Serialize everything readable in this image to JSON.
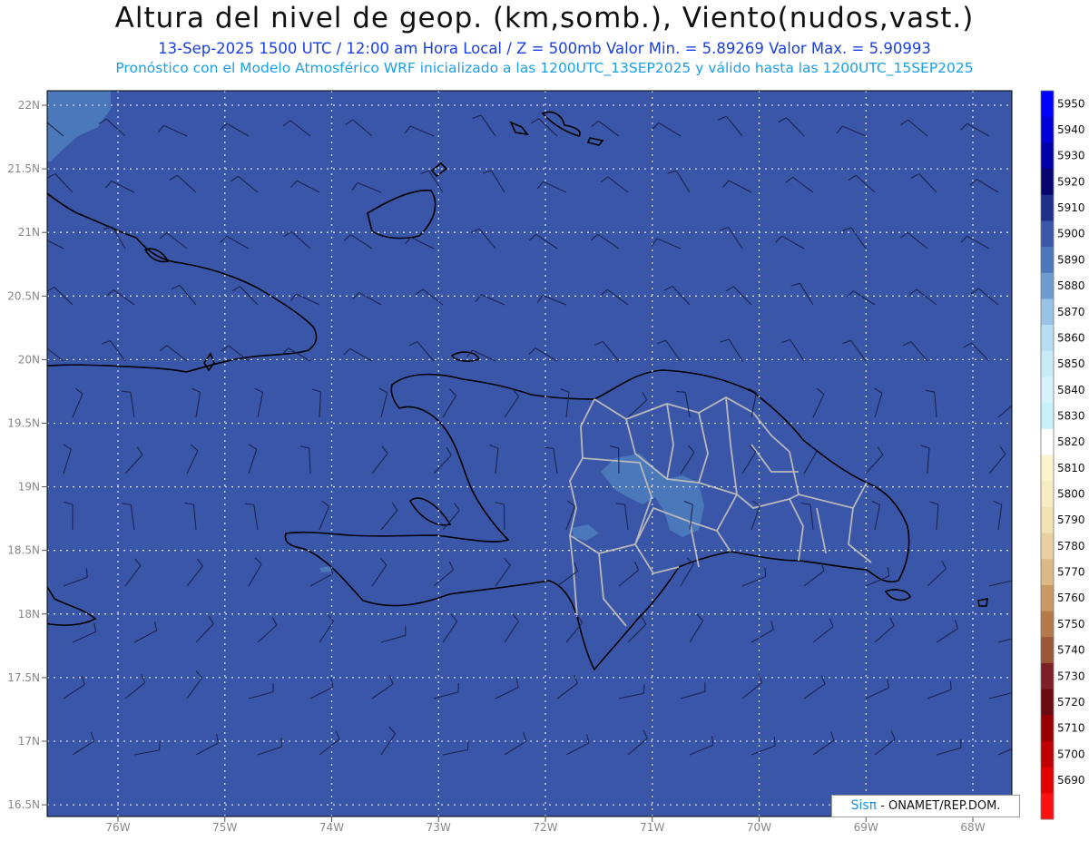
{
  "header": {
    "title": "Altura del nivel de geop. (km,somb.), Viento(nudos,vast.)",
    "subtitle_line1": "13-Sep-2025  1500 UTC / 12:00 am Hora Local / Z = 500mb    Valor Min. = 5.89269  Valor Max. = 5.90993",
    "subtitle_line2": "Pronóstico con el Modelo Atmosférico WRF inicializado a las 1200UTC_13SEP2025 y válido hasta las  1200UTC_15SEP2025"
  },
  "map": {
    "lat_labels": [
      "22N",
      "21.5N",
      "21N",
      "20.5N",
      "20N",
      "19.5N",
      "19N",
      "18.5N",
      "18N",
      "17.5N",
      "17N",
      "16.5N"
    ],
    "lon_labels": [
      "76W",
      "75W",
      "74W",
      "73W",
      "72W",
      "71W",
      "70W",
      "69W",
      "68W"
    ],
    "background_color": "#3a56a8",
    "grid": true
  },
  "colorbar": {
    "levels": [
      "5950",
      "5940",
      "5930",
      "5920",
      "5910",
      "5900",
      "5890",
      "5880",
      "5870",
      "5860",
      "5850",
      "5840",
      "5830",
      "5820",
      "5810",
      "5800",
      "5790",
      "5780",
      "5770",
      "5760",
      "5750",
      "5740",
      "5730",
      "5720",
      "5710",
      "5700",
      "5690"
    ],
    "colors": [
      "#0000ff",
      "#0000d8",
      "#0000a8",
      "#06066e",
      "#1e2f8a",
      "#3a56a8",
      "#4a78bb",
      "#6d9ccf",
      "#99c2e3",
      "#b7def0",
      "#c9ebf6",
      "#d5f1f9",
      "#c7f1f9",
      "#ffffff",
      "#fbf3cc",
      "#f7ebc1",
      "#f2e1b4",
      "#e9d0a1",
      "#ddb985",
      "#c99a63",
      "#b47a4b",
      "#9a5637",
      "#7d1f26",
      "#6c0a12",
      "#960000",
      "#c00000",
      "#e20000",
      "#ff1010"
    ]
  },
  "credit": {
    "logo": "Sisπ",
    "text": "- ONAMET/REP.DOM."
  }
}
